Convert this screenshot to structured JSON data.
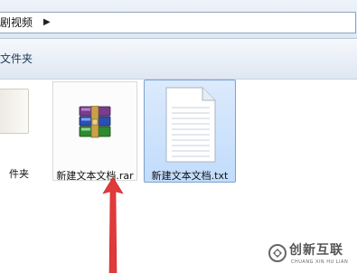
{
  "address_bar": {
    "crumb": "剧视频",
    "arrow_icon": "chevron-right-icon"
  },
  "toolbar": {
    "new_folder_label": "文件夹"
  },
  "files": [
    {
      "name": "件夹",
      "type": "folder",
      "icon": "folder-icon"
    },
    {
      "name": "新建文本文档.rar",
      "type": "rar",
      "icon": "winrar-archive-icon"
    },
    {
      "name": "新建文本文档.txt",
      "type": "txt",
      "icon": "text-document-icon",
      "selected": true
    }
  ],
  "annotation": {
    "arrow_color": "#e03a3a",
    "points_to": "新建文本文档.rar"
  },
  "watermark": {
    "text": "创新互联",
    "subtext": "CHUANG XIN HU LIAN"
  },
  "colors": {
    "selection_bg": "#c9e0fc",
    "selection_border": "#7da2ce"
  }
}
